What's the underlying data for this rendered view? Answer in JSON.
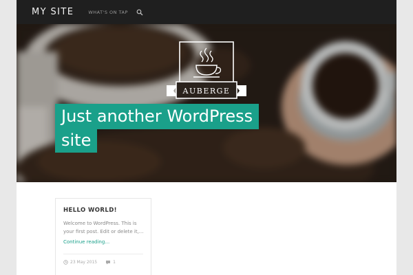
{
  "header": {
    "site_title": "MY SITE",
    "nav": [
      {
        "label": "WHAT'S ON TAP"
      }
    ],
    "search_icon": "search-icon"
  },
  "hero": {
    "logo_text": "AUBERGE",
    "tagline_line1": "Just another WordPress",
    "tagline_line2": "site"
  },
  "post": {
    "title": "HELLO WORLD!",
    "excerpt": "Welcome to WordPress. This is your first post. Edit or delete it,...",
    "read_more": "Continue reading…",
    "date": "23 May 2015",
    "comments": "1"
  },
  "colors": {
    "accent": "#1aa08a",
    "topbar": "#1f1f1f",
    "page_bg": "#e8e8e8"
  }
}
